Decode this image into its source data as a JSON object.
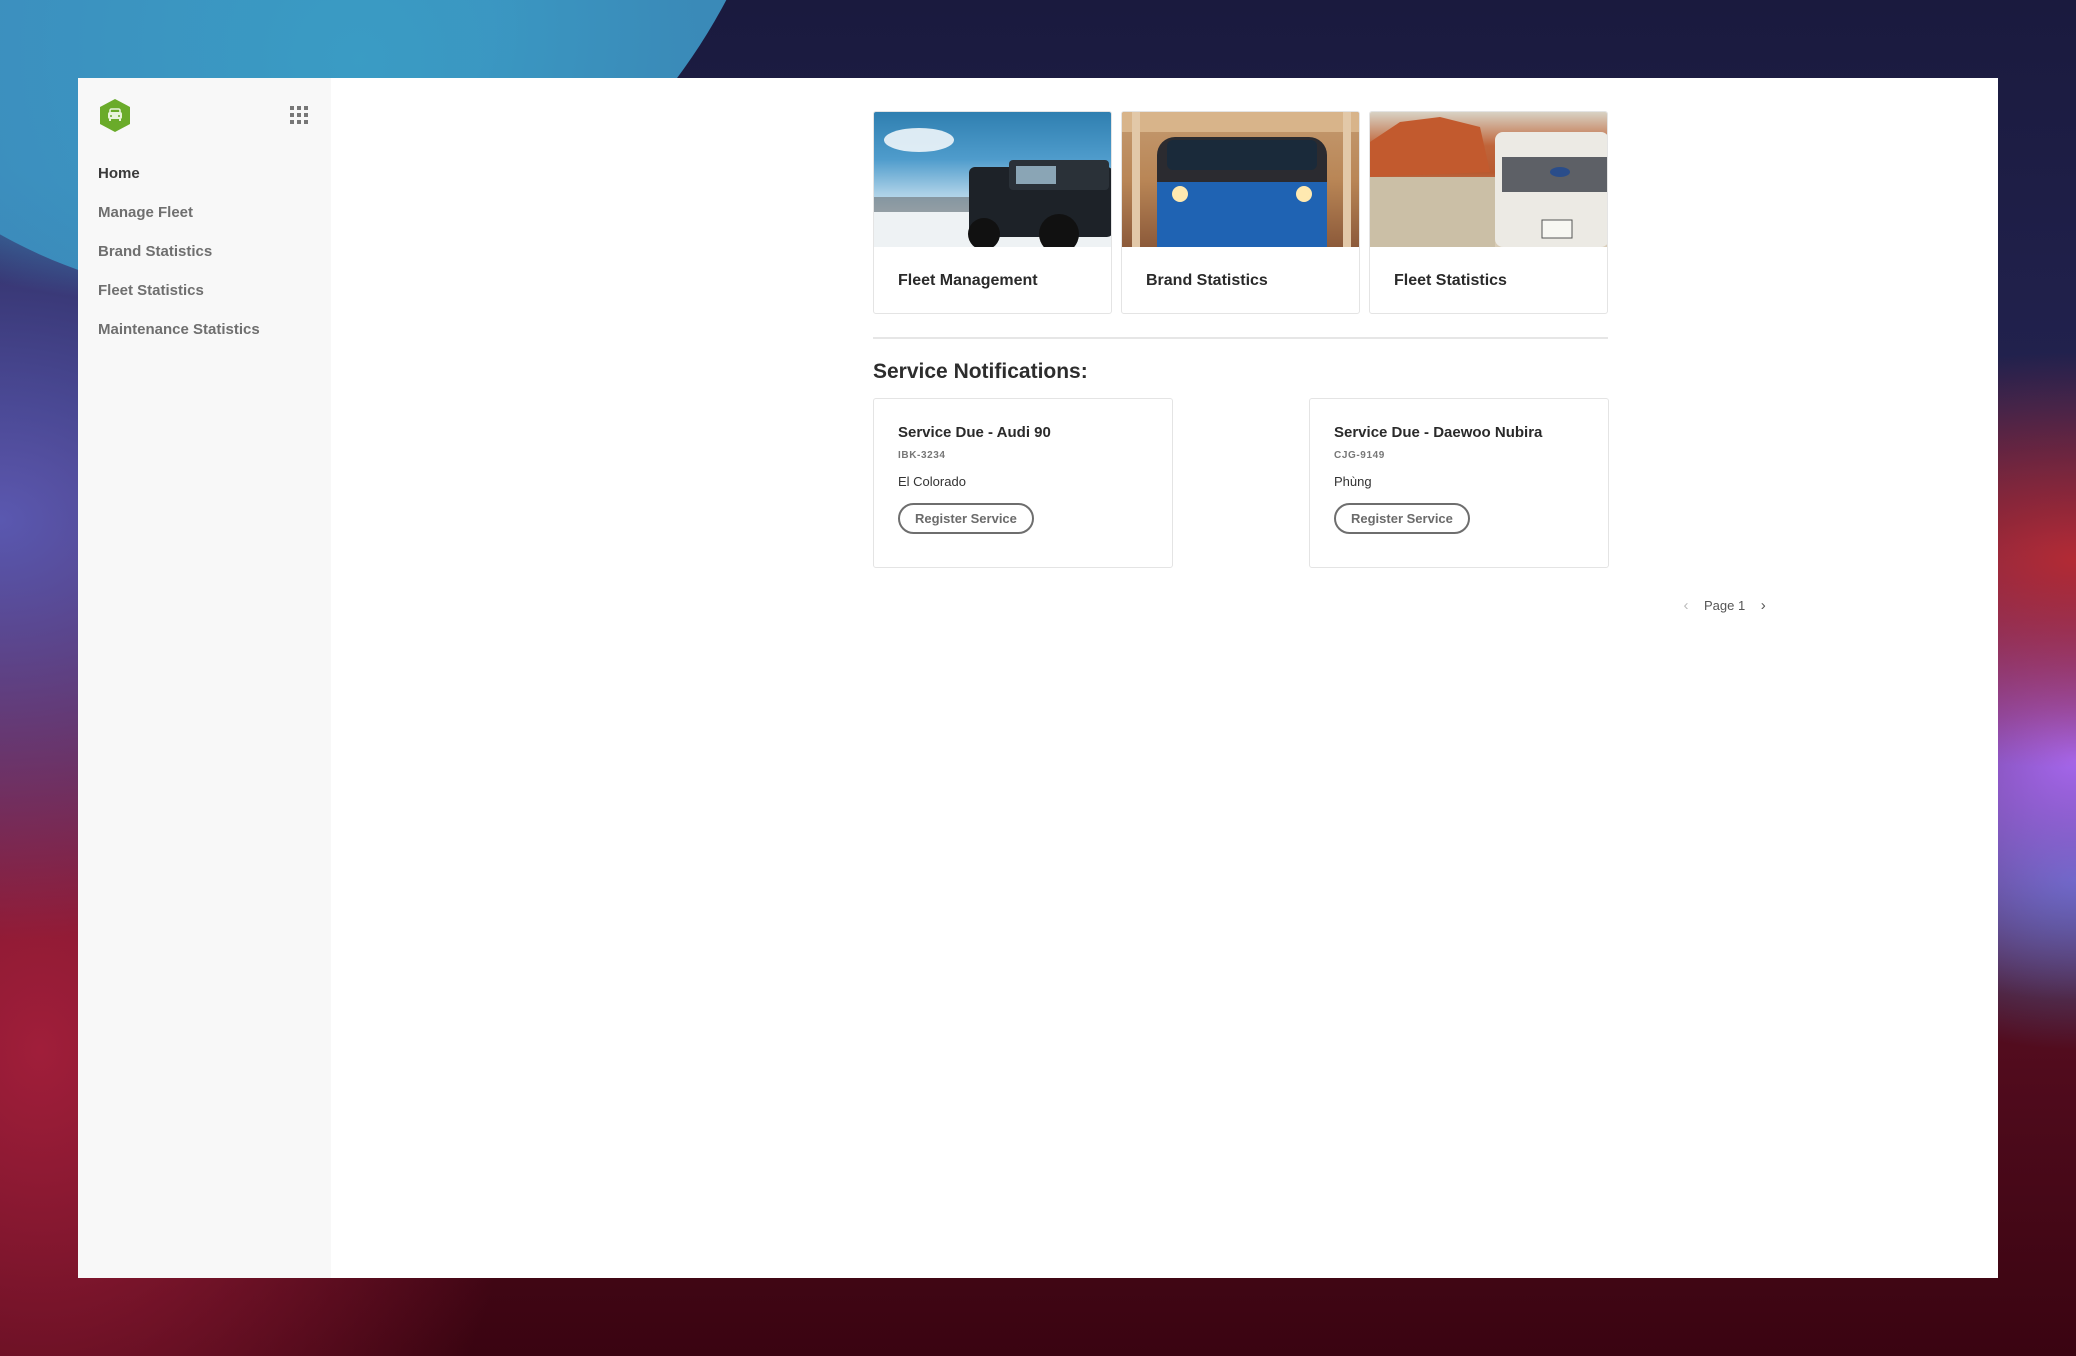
{
  "app": {
    "logo_icon": "car-hexagon-icon",
    "apps_icon": "grid-apps-icon",
    "brand_color": "#6aab2a"
  },
  "sidebar": {
    "items": [
      {
        "label": "Home",
        "active": true
      },
      {
        "label": "Manage Fleet",
        "active": false
      },
      {
        "label": "Brand Statistics",
        "active": false
      },
      {
        "label": "Fleet Statistics",
        "active": false
      },
      {
        "label": "Maintenance Statistics",
        "active": false
      }
    ]
  },
  "tiles": [
    {
      "title": "Fleet Management",
      "image": "black jeep on salt flats under blue sky"
    },
    {
      "title": "Brand Statistics",
      "image": "blue car with headlights on a bridge"
    },
    {
      "title": "Fleet Statistics",
      "image": "white SUV in red rock desert"
    }
  ],
  "notifications": {
    "heading": "Service Notifications:",
    "items": [
      {
        "title": "Service Due - Audi 90",
        "plate": "IBK-3234",
        "location": "El Colorado",
        "button": "Register Service"
      },
      {
        "title": "Service Due - Daewoo Nubira",
        "plate": "CJG-9149",
        "location": "Phùng",
        "button": "Register Service"
      }
    ]
  },
  "pagination": {
    "prev_icon": "chevron-left-icon",
    "label": "Page 1",
    "next_icon": "chevron-right-icon",
    "prev_glyph": "‹",
    "next_glyph": "›"
  }
}
